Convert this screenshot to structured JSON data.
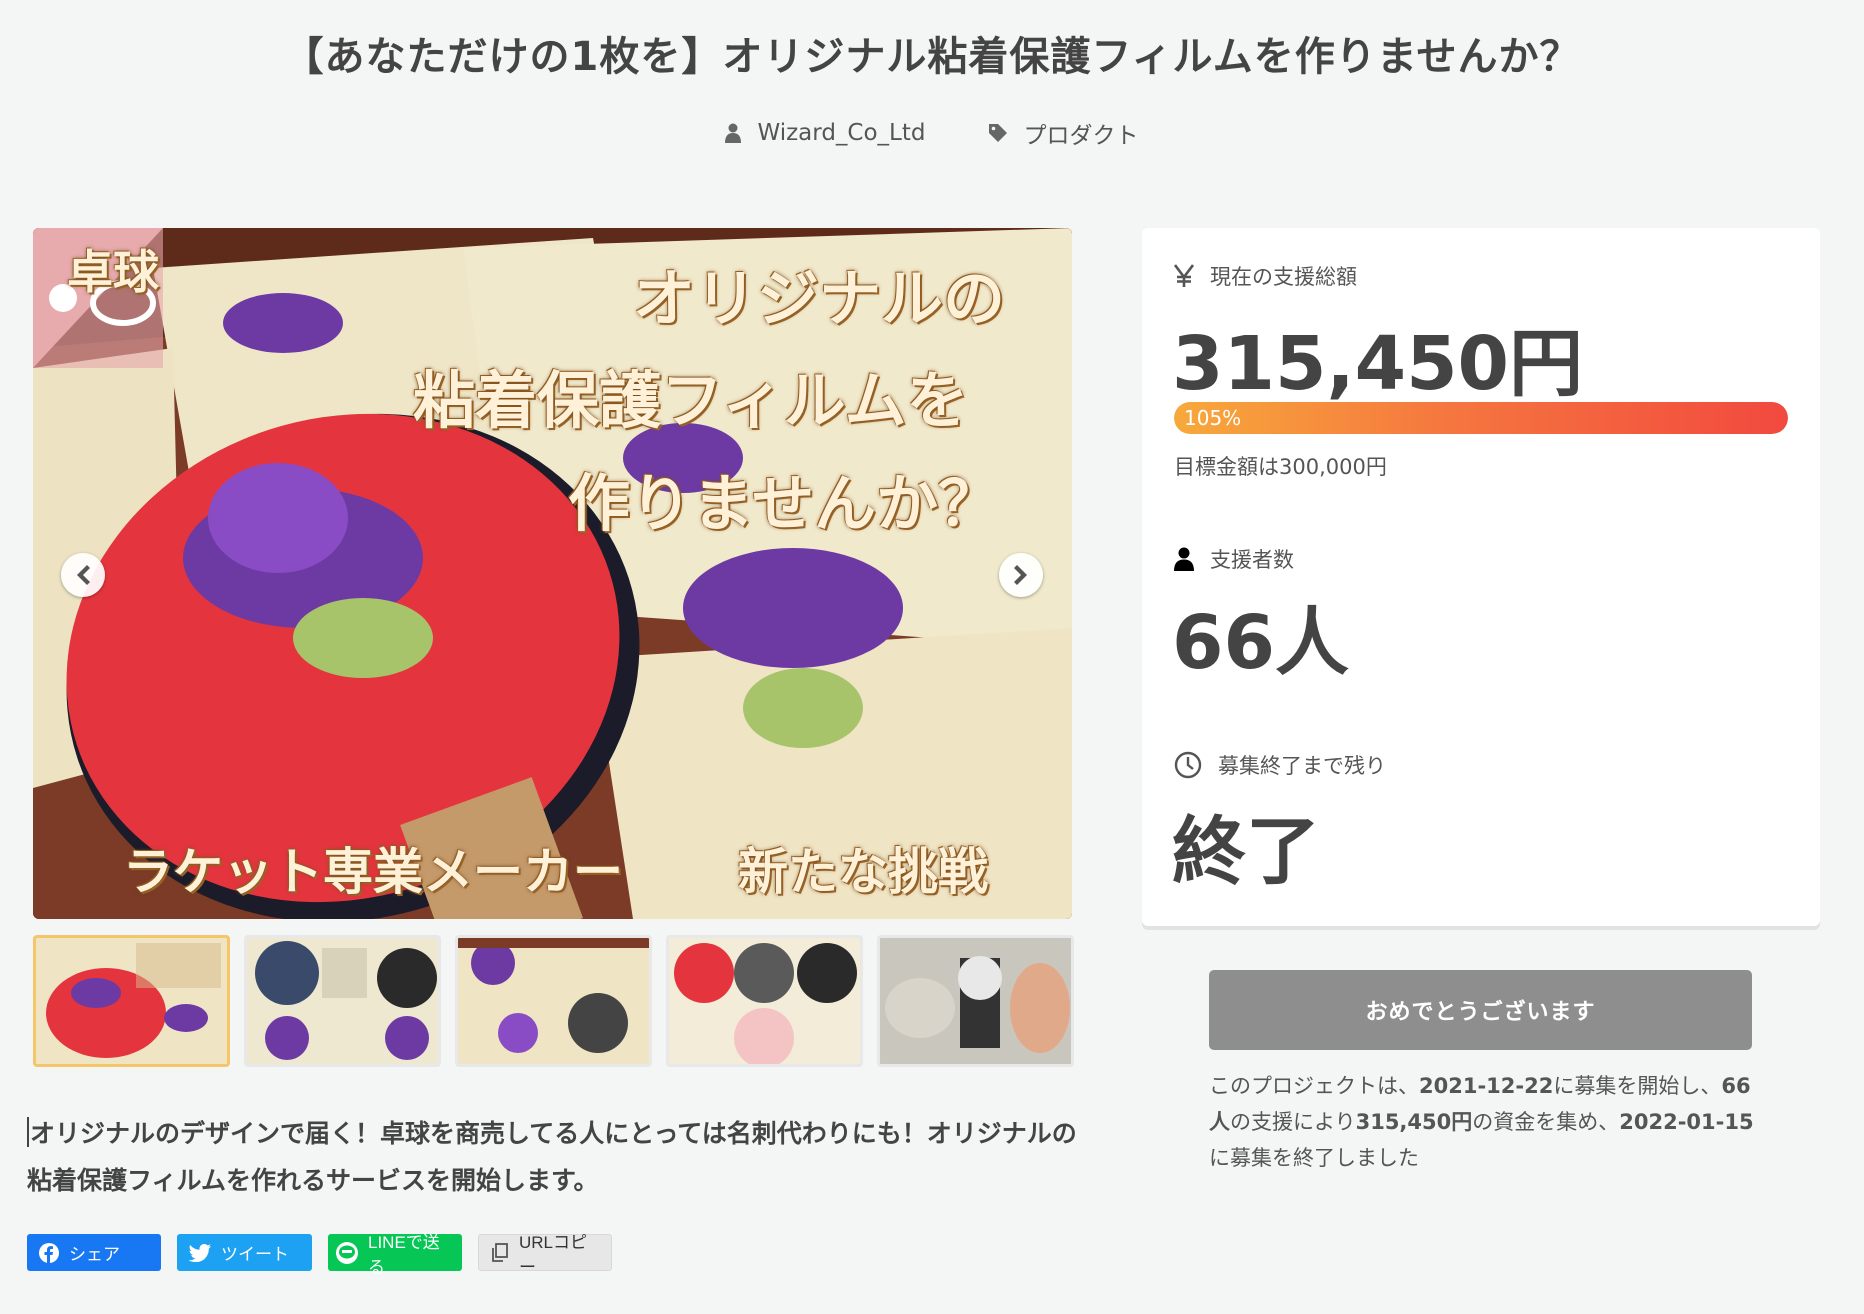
{
  "project": {
    "title": "【あなただけの1枚を】オリジナル粘着保護フィルムを作りませんか？",
    "author": "Wizard_Co_Ltd",
    "category": "プロダクト"
  },
  "hero": {
    "corner_text": "卓球",
    "caption_line1": "オリジナルの",
    "caption_line2": "粘着保護フィルムを",
    "caption_line3": "作りませんか？",
    "caption_bottom_left": "ラケット専業メーカー",
    "caption_bottom_right": "新たな挑戦"
  },
  "thumbnails": [
    {
      "name": "thumb-1",
      "active": true
    },
    {
      "name": "thumb-2",
      "active": false
    },
    {
      "name": "thumb-3",
      "active": false
    },
    {
      "name": "thumb-4",
      "active": false
    },
    {
      "name": "thumb-5",
      "active": false
    }
  ],
  "description": "オリジナルのデザインで届く！卓球を商売してる人にとっては名刺代わりにも！オリジナルの粘着保護フィルムを作れるサービスを開始します。",
  "share": {
    "facebook": "シェア",
    "twitter": "ツイート",
    "line": "LINEで送る",
    "copy": "URLコピー"
  },
  "stats": {
    "total_label": "現在の支援総額",
    "total_value": "315,450円",
    "progress_text": "105%",
    "progress_fraction": 1.0,
    "goal_text": "目標金額は300,000円",
    "backers_label": "支援者数",
    "backers_value": "66人",
    "remaining_label": "募集終了まで残り",
    "remaining_value": "終了"
  },
  "cta": {
    "label": "おめでとうございます"
  },
  "summary": {
    "prefix": "このプロジェクトは、",
    "start_date": "2021-12-22",
    "mid1": "に募集を開始し、",
    "backers": "66人",
    "mid2": "の支援により",
    "amount": "315,450円",
    "mid3": "の資金を集め、",
    "end_date": "2022-01-15",
    "suffix": "に募集を終了しました"
  },
  "colors": {
    "progress_start": "#f7a93b",
    "progress_end": "#f2493f",
    "facebook": "#1877f2",
    "twitter": "#1da1f2",
    "line": "#06c755"
  }
}
